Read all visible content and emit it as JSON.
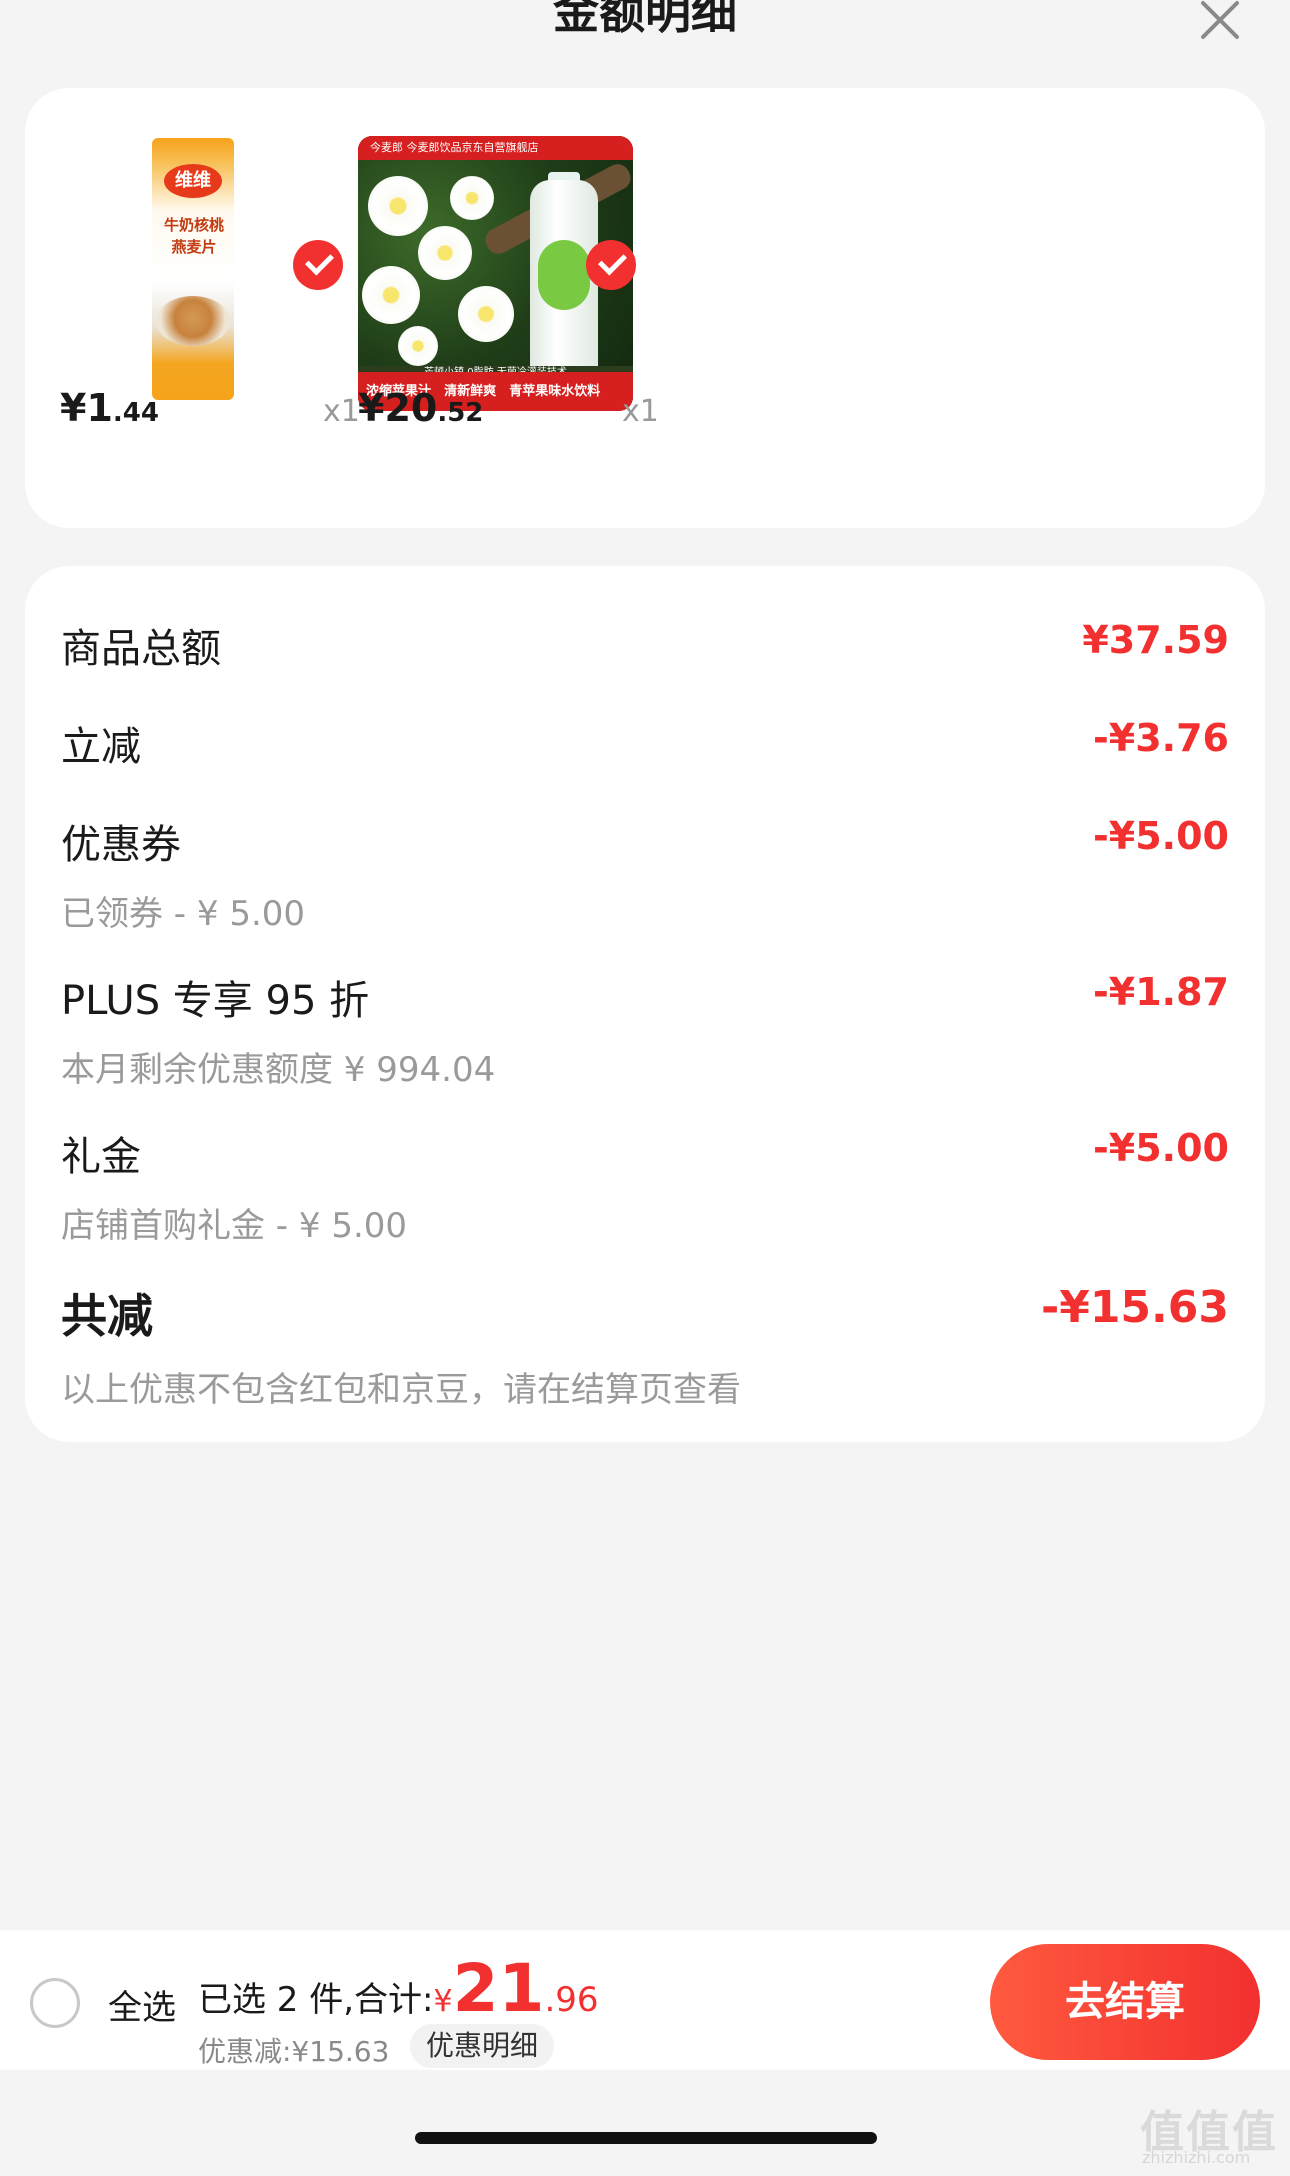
{
  "header": {
    "title": "金额明细"
  },
  "products": [
    {
      "price_int": "¥1",
      "price_dec": ".44",
      "qty": "x1",
      "thumb_lines": [
        "牛奶核桃",
        "燕麦片"
      ],
      "brand": "维维"
    },
    {
      "price_int": "¥20",
      "price_dec": ".52",
      "qty": "x1",
      "store": "今麦郎 今麦郎饮品京东自营旗舰店",
      "strip": "芒顿小镇  0脂肪  无菌冷灌装技术",
      "tags": [
        "浓缩苹果汁",
        "清新鲜爽",
        "青苹果味水饮料"
      ]
    }
  ],
  "detail": {
    "goods_total_label": "商品总额",
    "goods_total_value": "¥37.59",
    "instant_label": "立减",
    "instant_value": "-¥3.76",
    "coupon_label": "优惠券",
    "coupon_sub": "已领券 - ¥ 5.00",
    "coupon_value": "-¥5.00",
    "plus_label": "PLUS 专享 95 折",
    "plus_sub": "本月剩余优惠额度 ¥ 994.04",
    "plus_value": "-¥1.87",
    "gift_label": "礼金",
    "gift_sub": "店铺首购礼金 - ¥ 5.00",
    "gift_value": "-¥5.00",
    "total_label": "共减",
    "total_sub": "以上优惠不包含红包和京豆，请在结算页查看",
    "total_value": "-¥15.63"
  },
  "bottom": {
    "select_all": "全选",
    "selected_text": "已选 2 件,合计:",
    "total_yen": "¥",
    "total_int": "21",
    "total_dec": ".96",
    "discount_text": "优惠减:¥15.63",
    "detail_link": "优惠明细",
    "checkout": "去结算"
  },
  "watermark": {
    "main": "值值值",
    "sub": "zhizhizhi.com"
  },
  "colors": {
    "accent": "#f2302f",
    "muted": "#9a9a9a",
    "background": "#f4f4f4"
  }
}
